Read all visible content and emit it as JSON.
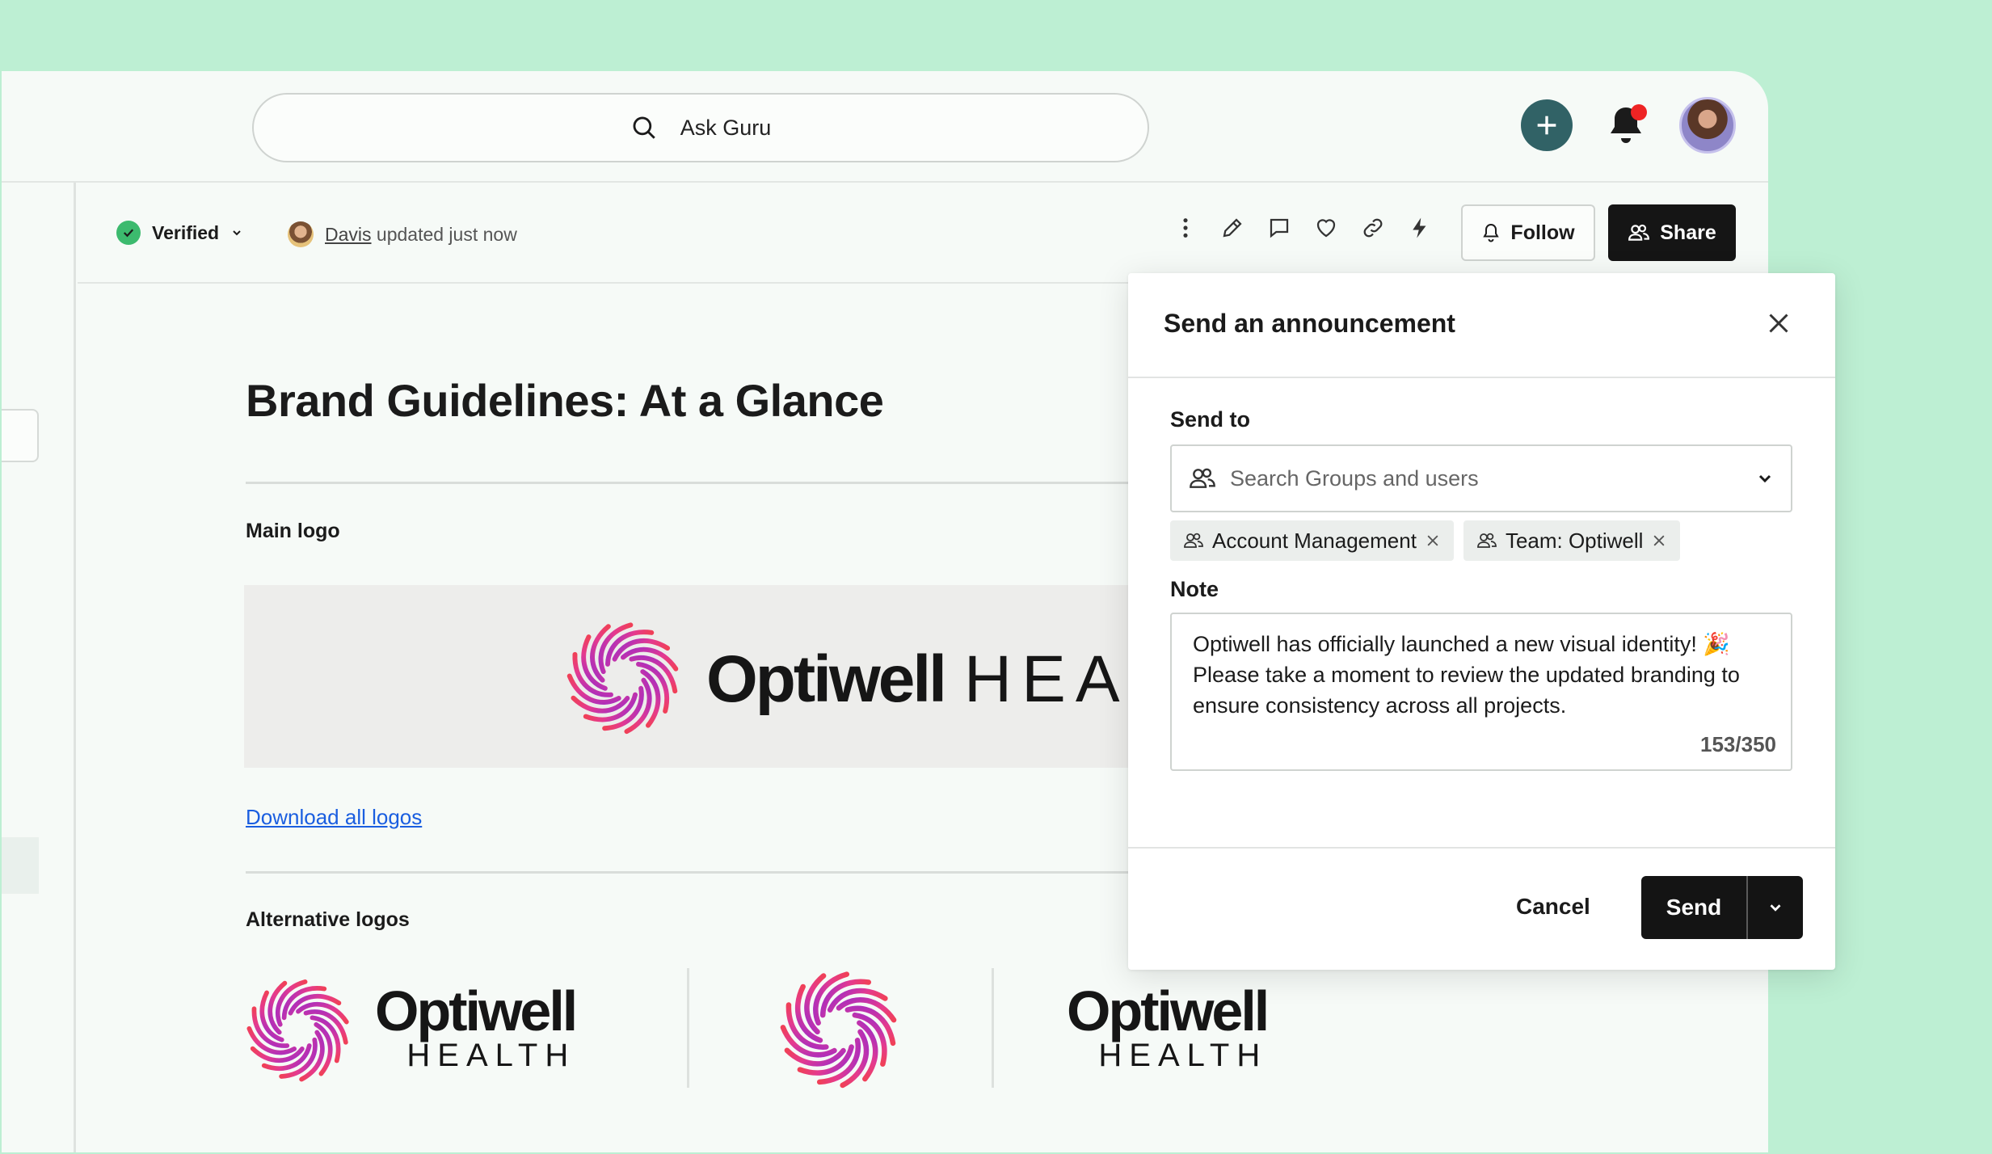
{
  "header": {
    "search_placeholder": "Ask Guru"
  },
  "card_toolbar": {
    "status_label": "Verified",
    "updated_by": "Davis",
    "updated_text": "updated just now",
    "follow_label": "Follow",
    "share_label": "Share"
  },
  "document": {
    "title": "Brand Guidelines: At a Glance",
    "main_logo_label": "Main logo",
    "banner_wordmark": "Optiwell",
    "banner_wordmark_suffix": "HEA",
    "download_link": "Download all logos",
    "alternative_logos_label": "Alternative logos",
    "alt_wordmark": "Optiwell",
    "alt_wordmark_sub": "HEALTH"
  },
  "modal": {
    "title": "Send an announcement",
    "send_to_label": "Send to",
    "recipient_placeholder": "Search Groups and users",
    "chips": [
      {
        "label": "Account Management"
      },
      {
        "label": "Team: Optiwell"
      }
    ],
    "note_label": "Note",
    "note_text": "Optiwell has officially launched a new visual identity! 🎉 Please take a moment to review the updated branding to ensure consistency across all projects.",
    "note_count": "153/350",
    "cancel_label": "Cancel",
    "send_label": "Send"
  },
  "colors": {
    "background": "#bdefd3",
    "add_button": "#316266",
    "notification_dot": "#ee2424",
    "verified_green": "#3cba6e",
    "link_blue": "#1a5ee0",
    "primary_dark": "#141414"
  },
  "icons": {
    "search": "search-icon",
    "add": "plus-icon",
    "notifications": "bell-icon",
    "more": "more-vertical-icon",
    "edit": "pencil-icon",
    "comment": "comment-icon",
    "favorite": "heart-icon",
    "link": "link-icon",
    "action": "bolt-icon",
    "group": "users-icon",
    "close": "close-icon"
  }
}
